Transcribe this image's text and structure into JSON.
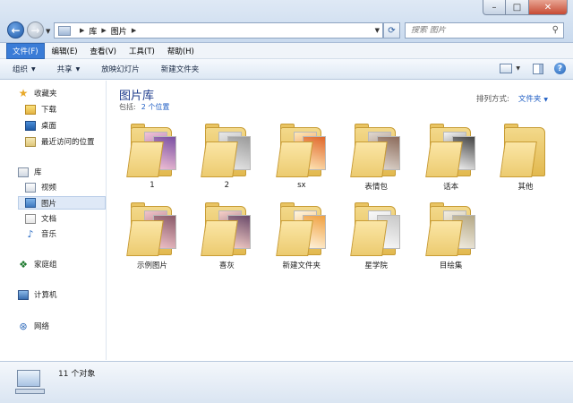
{
  "address": {
    "segments": [
      "库",
      "图片"
    ]
  },
  "search": {
    "placeholder": "搜索 图片"
  },
  "menu": [
    "文件(F)",
    "编辑(E)",
    "查看(V)",
    "工具(T)",
    "帮助(H)"
  ],
  "toolbar": {
    "organize": "组织",
    "share": "共享",
    "slideshow": "放映幻灯片",
    "new_folder": "新建文件夹"
  },
  "nav": {
    "favorites": "收藏夹",
    "downloads": "下载",
    "desktop": "桌面",
    "recent": "最近访问的位置",
    "libraries": "库",
    "videos": "视频",
    "pictures": "图片",
    "documents": "文档",
    "music": "音乐",
    "homegroup": "家庭组",
    "computer": "计算机",
    "network": "网络"
  },
  "content": {
    "title": "图片库",
    "includes_label": "包括:",
    "includes_link": "2 个位置",
    "arrange_label": "排列方式:",
    "arrange_value": "文件夹"
  },
  "folders": [
    {
      "label": "1",
      "icon": "folder-pictures-icon"
    },
    {
      "label": "2",
      "icon": "folder-pictures-icon"
    },
    {
      "label": "sx",
      "icon": "folder-pictures-icon"
    },
    {
      "label": "表情包",
      "icon": "folder-pictures-icon"
    },
    {
      "label": "话本",
      "icon": "folder-pictures-icon"
    },
    {
      "label": "其他",
      "icon": "folder-icon"
    },
    {
      "label": "示例图片",
      "icon": "folder-pictures-icon"
    },
    {
      "label": "喜灰",
      "icon": "folder-pictures-icon"
    },
    {
      "label": "新建文件夹",
      "icon": "folder-pictures-icon"
    },
    {
      "label": "星学院",
      "icon": "folder-documents-icon"
    },
    {
      "label": "目绘集",
      "icon": "folder-documents-icon"
    }
  ],
  "status": {
    "count_text": "11 个对象"
  }
}
